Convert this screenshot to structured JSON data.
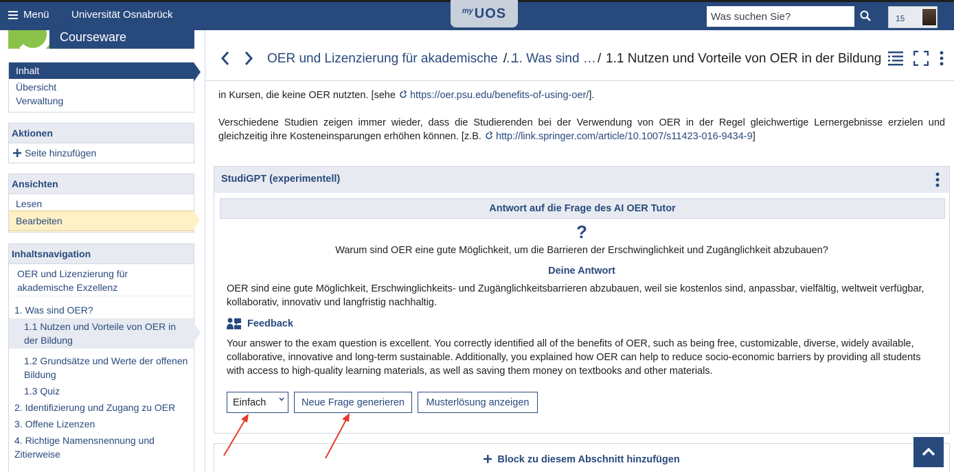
{
  "topbar": {
    "menu_label": "Menü",
    "university": "Universität Osnabrück",
    "logo_my": "my",
    "logo_uos": "UOS",
    "search_placeholder": "Was suchen Sie?",
    "notification_count": "15"
  },
  "sidebar": {
    "course_title": "Courseware",
    "nav_items": [
      "Inhalt",
      "Übersicht",
      "Verwaltung"
    ],
    "actions_title": "Aktionen",
    "action_add_page": "Seite hinzufügen",
    "views_title": "Ansichten",
    "view_items": [
      "Lesen",
      "Bearbeiten"
    ],
    "toc_title": "Inhaltsnavigation",
    "toc_root": "OER und Lizenzierung für akademische Exzellenz",
    "toc": [
      "1. Was sind OER?",
      "1.1 Nutzen und Vorteile von OER in der Bildung",
      "1.2 Grundsätze und Werte der offenen Bildung",
      "1.3 Quiz",
      "2. Identifizierung und Zugang zu OER",
      "3. Offene Lizenzen",
      "4. Richtige Namensnennung und Zitierweise"
    ]
  },
  "header": {
    "crumb_1": "OER und Lizenzierung für akademische …",
    "crumb_2": "1. Was sind …",
    "crumb_current": "1.1 Nutzen und Vorteile von OER in der Bildung",
    "sep": "/"
  },
  "content": {
    "para1_text": "in Kursen, die keine OER nutzten. [sehe ",
    "para1_link": "https://oer.psu.edu/benefits-of-using-oer/",
    "para1_end": "].",
    "para2_text": "Verschiedene Studien zeigen immer wieder, dass die Studierenden bei der Verwendung von OER in der Regel gleichwertige Lernergebnisse erzielen und gleichzeitig ihre Kosteneinsparungen erhöhen können. [z.B. ",
    "para2_link": "http://link.springer.com/article/10.1007/s11423-016-9434-9",
    "para2_end": "]"
  },
  "block": {
    "title": "StudiGPT (experimentell)",
    "inner_title": "Antwort auf die Frage des AI OER Tutor",
    "qmark": "?",
    "question": "Warum sind OER eine gute Möglichkeit, um die Barrieren der Erschwinglichkeit und Zugänglichkeit abzubauen?",
    "answer_label": "Deine Antwort",
    "answer": "OER sind eine gute Möglichkeit, Erschwinglichkeits- und Zugänglichkeitsbarrieren abzubauen, weil sie kostenlos sind, anpassbar, vielfältig, weltweit verfügbar, kollaborativ, innovativ und langfristig nachhaltig.",
    "feedback_label": "Feedback",
    "feedback": "Your answer to the exam question is excellent. You correctly identified all of the benefits of OER, such as being free, customizable, diverse, widely available, collaborative, innovative and long-term sustainable. Additionally, you explained how OER can help to reduce socio-economic barriers by providing all students with access to high-quality learning materials, as well as saving them money on textbooks and other materials.",
    "level_selected": "Einfach",
    "btn_new_question": "Neue Frage generieren",
    "btn_solution": "Musterlösung anzeigen"
  },
  "add_block_label": "Block zu diesem Abschnitt hinzufügen",
  "colors": {
    "primary": "#28497c",
    "light": "#e7ebf1",
    "highlight": "#fff1c7",
    "annotation": "#e53b2c"
  }
}
